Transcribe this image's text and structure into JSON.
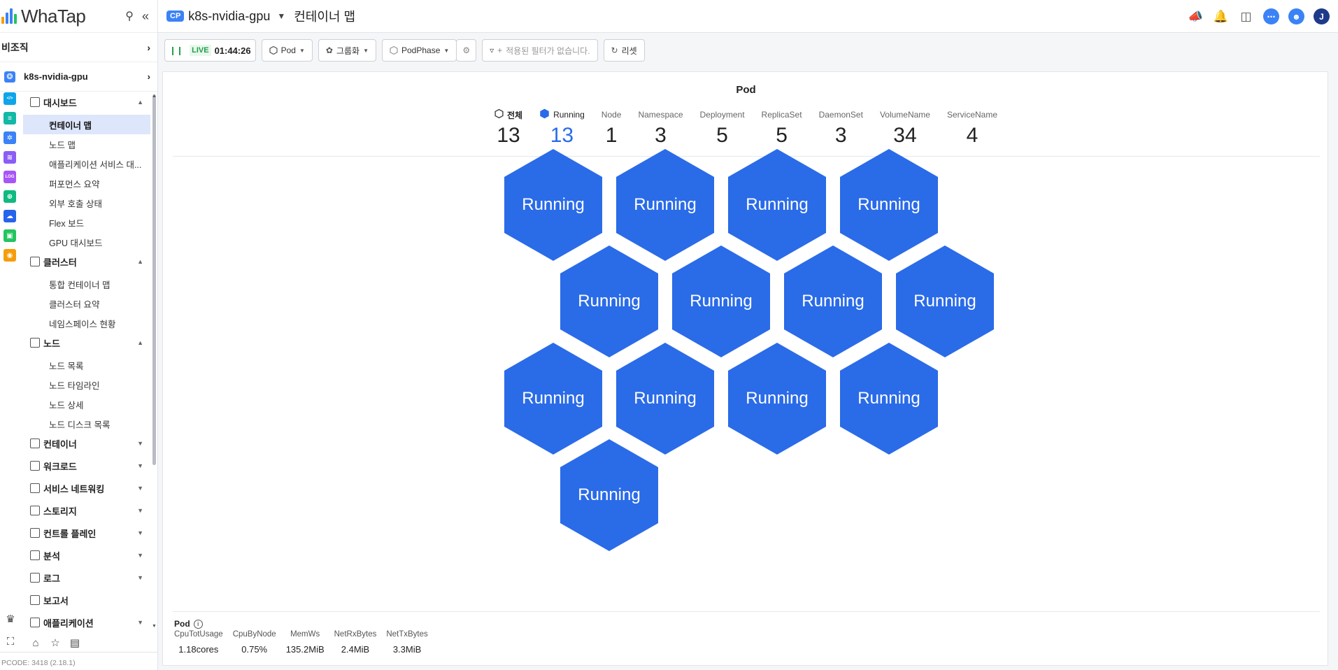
{
  "sidebar": {
    "logo": {
      "text": "WhaTap",
      "bar_colors": [
        "#f59e0b",
        "#3b82f6",
        "#3b82f6",
        "#22c55e"
      ]
    },
    "org_label": "비조직",
    "project_label": "k8s-nvidia-gpu",
    "groups": [
      {
        "label": "대시보드",
        "expanded": true,
        "items": [
          {
            "label": "컨테이너 맵",
            "active": true
          },
          {
            "label": "노드 맵"
          },
          {
            "label": "애플리케이션 서비스 대..."
          },
          {
            "label": "퍼포먼스 요약"
          },
          {
            "label": "외부 호출 상태"
          },
          {
            "label": "Flex 보드"
          },
          {
            "label": "GPU 대시보드"
          }
        ]
      },
      {
        "label": "클러스터",
        "expanded": true,
        "items": [
          {
            "label": "통합 컨테이너 맵"
          },
          {
            "label": "클러스터 요약"
          },
          {
            "label": "네임스페이스 현황"
          }
        ]
      },
      {
        "label": "노드",
        "expanded": true,
        "items": [
          {
            "label": "노드 목록"
          },
          {
            "label": "노드 타임라인"
          },
          {
            "label": "노드 상세"
          },
          {
            "label": "노드 디스크 목록"
          }
        ]
      },
      {
        "label": "컨테이너",
        "expanded": false,
        "items": []
      },
      {
        "label": "워크로드",
        "expanded": false,
        "items": []
      },
      {
        "label": "서비스 네트워킹",
        "expanded": false,
        "items": []
      },
      {
        "label": "스토리지",
        "expanded": false,
        "items": []
      },
      {
        "label": "컨트롤 플레인",
        "expanded": false,
        "items": []
      },
      {
        "label": "분석",
        "expanded": false,
        "items": []
      },
      {
        "label": "로그",
        "expanded": false,
        "items": []
      },
      {
        "label": "보고서",
        "expanded": null,
        "items": []
      },
      {
        "label": "애플리케이션",
        "expanded": false,
        "items": []
      }
    ],
    "rail_icons": [
      {
        "name": "code-icon",
        "color": "#0ea5e9",
        "glyph": "</>"
      },
      {
        "name": "server-icon",
        "color": "#14b8a6",
        "glyph": "≡"
      },
      {
        "name": "kubernetes-icon",
        "color": "#3b82f6",
        "glyph": "✲"
      },
      {
        "name": "database-icon",
        "color": "#8b5cf6",
        "glyph": "≋"
      },
      {
        "name": "log-icon",
        "color": "#a855f7",
        "glyph": "LOG"
      },
      {
        "name": "network-icon",
        "color": "#10b981",
        "glyph": "⊕"
      },
      {
        "name": "cloud-icon",
        "color": "#2563eb",
        "glyph": "☁"
      },
      {
        "name": "browser-icon",
        "color": "#22c55e",
        "glyph": "▣"
      },
      {
        "name": "signal-icon",
        "color": "#f59e0b",
        "glyph": "◉"
      }
    ],
    "pcode": "PCODE: 3418 (2.18.1)"
  },
  "header": {
    "badge": "CP",
    "project": "k8s-nvidia-gpu",
    "page_title": "컨테이너 맵",
    "avatar_letter": "J"
  },
  "toolbar": {
    "live_label": "LIVE",
    "live_time": "01:44:26",
    "pod_label": "Pod",
    "group_label": "그룹화",
    "phase_label": "PodPhase",
    "filter_placeholder": "적용된 필터가 없습니다.",
    "reset_label": "리셋"
  },
  "panel": {
    "title": "Pod",
    "stats": [
      {
        "label": "전체",
        "value": "13",
        "kind": "all"
      },
      {
        "label": "Running",
        "value": "13",
        "kind": "running"
      },
      {
        "label": "Node",
        "value": "1"
      },
      {
        "label": "Namespace",
        "value": "3"
      },
      {
        "label": "Deployment",
        "value": "5"
      },
      {
        "label": "ReplicaSet",
        "value": "5"
      },
      {
        "label": "DaemonSet",
        "value": "3"
      },
      {
        "label": "VolumeName",
        "value": "34"
      },
      {
        "label": "ServiceName",
        "value": "4"
      }
    ],
    "pods": [
      {
        "status": "Running"
      },
      {
        "status": "Running"
      },
      {
        "status": "Running"
      },
      {
        "status": "Running"
      },
      {
        "status": "Running"
      },
      {
        "status": "Running"
      },
      {
        "status": "Running"
      },
      {
        "status": "Running"
      },
      {
        "status": "Running"
      },
      {
        "status": "Running"
      },
      {
        "status": "Running"
      },
      {
        "status": "Running"
      },
      {
        "status": "Running"
      }
    ],
    "pod_color": "#2a6be8",
    "bottom": {
      "title": "Pod",
      "metrics": [
        {
          "label": "CpuTotUsage",
          "value": "1.18cores"
        },
        {
          "label": "CpuByNode",
          "value": "0.75%"
        },
        {
          "label": "MemWs",
          "value": "135.2MiB"
        },
        {
          "label": "NetRxBytes",
          "value": "2.4MiB"
        },
        {
          "label": "NetTxBytes",
          "value": "3.3MiB"
        }
      ]
    }
  }
}
